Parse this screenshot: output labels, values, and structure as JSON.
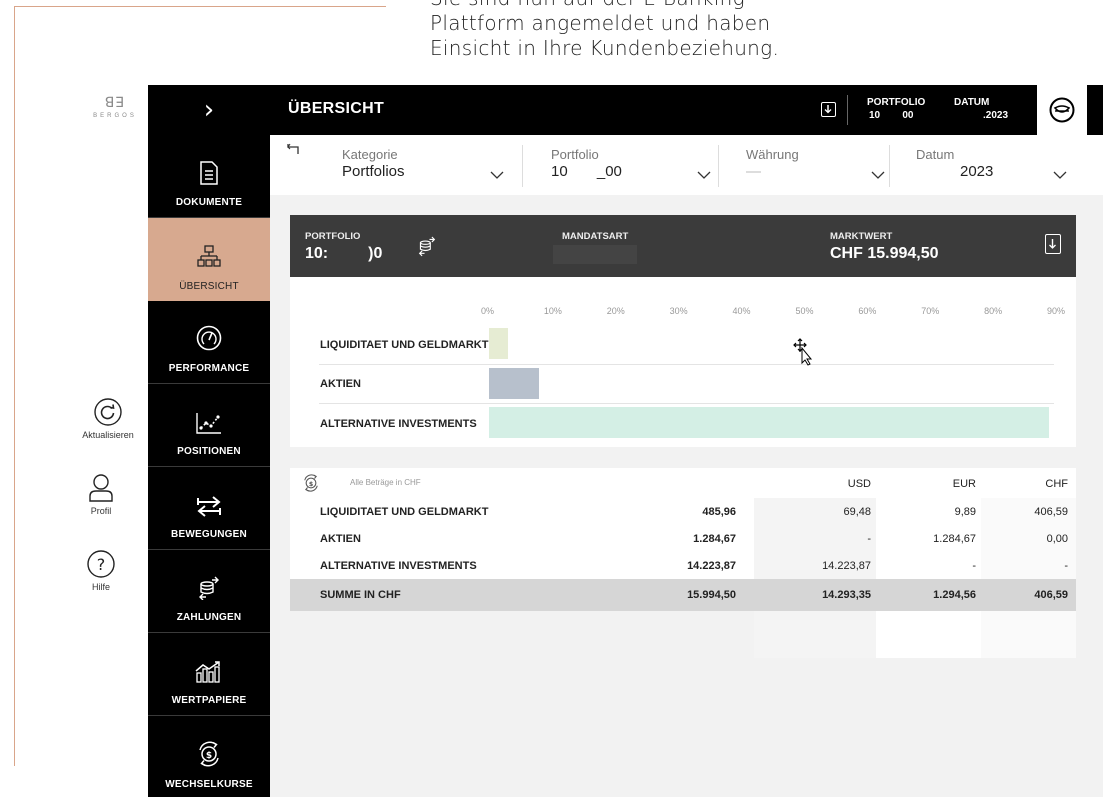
{
  "intro": {
    "lines": [
      "Sie sind nun auf der E-Banking",
      "Plattform angemeldet und haben",
      "Einsicht in Ihre Kundenbeziehung."
    ]
  },
  "logo": {
    "mark": "ꓭꓱ",
    "word": "BERGOS"
  },
  "utilities": [
    {
      "label": "Aktualisieren",
      "icon": "refresh-icon"
    },
    {
      "label": "Profil",
      "icon": "user-icon"
    },
    {
      "label": "Hilfe",
      "icon": "help-icon"
    }
  ],
  "nav": {
    "toggle": "›",
    "items": [
      {
        "label": "DOKUMENTE",
        "icon": "document-icon"
      },
      {
        "label": "ÜBERSICHT",
        "icon": "overview-icon",
        "active": true
      },
      {
        "label": "PERFORMANCE",
        "icon": "gauge-icon"
      },
      {
        "label": "POSITIONEN",
        "icon": "positions-chart-icon"
      },
      {
        "label": "BEWEGUNGEN",
        "icon": "transfer-arrows-icon"
      },
      {
        "label": "ZAHLUNGEN",
        "icon": "coins-icon"
      },
      {
        "label": "WERTPAPIERE",
        "icon": "securities-chart-icon"
      },
      {
        "label": "WECHSELKURSE",
        "icon": "exchange-icon"
      }
    ]
  },
  "header": {
    "title": "ÜBERSICHT",
    "portfolio_label": "PORTFOLIO",
    "portfolio_value": "10        00",
    "datum_label": "DATUM",
    "datum_value": ".2023"
  },
  "filters": {
    "kategorie": {
      "label": "Kategorie",
      "value": "Portfolios"
    },
    "portfolio": {
      "label": "Portfolio",
      "value": "10       _00"
    },
    "waehrung": {
      "label": "Währung",
      "value": "—"
    },
    "datum": {
      "label": "Datum",
      "value": "2023"
    }
  },
  "portfolio_header": {
    "portfolio_label": "PORTFOLIO",
    "portfolio_value": "10:         )0",
    "mandatsart_label": "MANDATSART",
    "marktwert_label": "MARKTWERT",
    "marktwert_value": "CHF 15.994,50"
  },
  "chart_data": {
    "type": "bar",
    "orientation": "horizontal",
    "categories": [
      "LIQUIDITAET UND GELDMARKT",
      "AKTIEN",
      "ALTERNATIVE INVESTMENTS"
    ],
    "values": [
      3,
      8,
      89
    ],
    "xlim": [
      0,
      90
    ],
    "x_ticks": [
      "0%",
      "10%",
      "20%",
      "30%",
      "40%",
      "50%",
      "60%",
      "70%",
      "80%",
      "90%"
    ],
    "colors": [
      "#e6ecd3",
      "#b7c0cc",
      "#d4efe5"
    ]
  },
  "table": {
    "note": "Alle Beträge in CHF",
    "columns": [
      "USD",
      "EUR",
      "CHF"
    ],
    "rows": [
      {
        "name": "LIQUIDITAET UND GELDMARKT",
        "total": "485,96",
        "usd": "69,48",
        "eur": "9,89",
        "chf": "406,59"
      },
      {
        "name": "AKTIEN",
        "total": "1.284,67",
        "usd": "-",
        "eur": "1.284,67",
        "chf": "0,00"
      },
      {
        "name": "ALTERNATIVE INVESTMENTS",
        "total": "14.223,87",
        "usd": "14.223,87",
        "eur": "-",
        "chf": "-"
      }
    ],
    "sum": {
      "name": "SUMME IN CHF",
      "total": "15.994,50",
      "usd": "14.293,35",
      "eur": "1.294,56",
      "chf": "406,59"
    }
  }
}
